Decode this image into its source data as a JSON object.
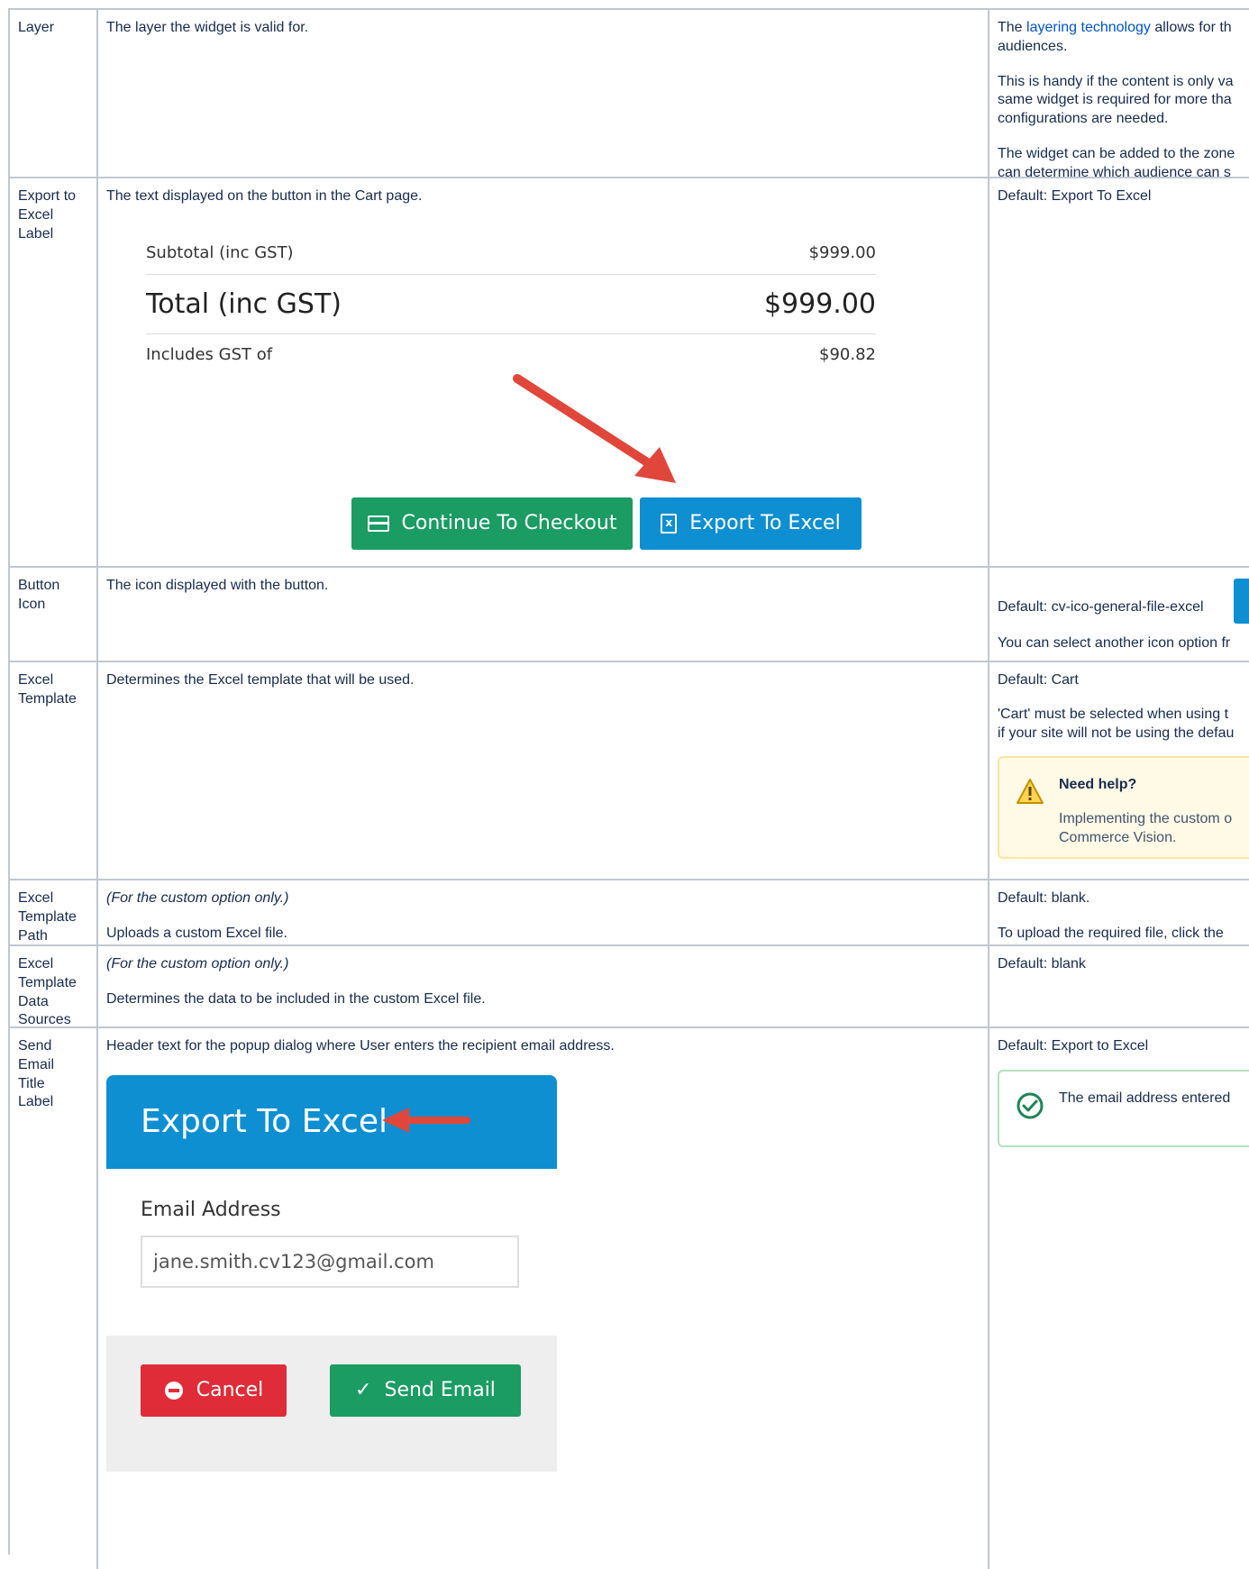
{
  "rows": [
    {
      "name": "Layer",
      "description": "The layer the widget is valid for.",
      "notes": {
        "p1_prefix": "The ",
        "p1_link": "layering technology",
        "p1_suffix": " allows for th",
        "p1_line2": "audiences.",
        "p2_line1": "This is handy if the content is only va",
        "p2_line2": "same widget is required for more tha",
        "p2_line3": "configurations are needed.",
        "p3_line1": "The widget can be added to the zone",
        "p3_line2": "can determine which audience can s"
      }
    },
    {
      "name": "Export to Excel Label",
      "description": "The text displayed on the button in the Cart page.",
      "notes": "Default: Export To Excel",
      "cart": {
        "subtotal_label": "Subtotal (inc GST)",
        "subtotal_value": "$999.00",
        "total_label": "Total (inc GST)",
        "total_value": "$999.00",
        "gst_label": "Includes GST of",
        "gst_value": "$90.82",
        "checkout_button": "Continue To Checkout",
        "export_button": "Export To Excel"
      }
    },
    {
      "name": "Button Icon",
      "description": "The icon displayed with the button.",
      "notes_default": "Default: cv-ico-general-file-excel",
      "notes_more": "You can select another icon option fr"
    },
    {
      "name": "Excel Template",
      "description": "Determines the Excel template that will be used.",
      "notes_default": "Default: Cart",
      "notes_line1": "'Cart' must be selected when using t",
      "notes_line2": "if your site will not be using the defau",
      "help_title": "Need help?",
      "help_line1": "Implementing the custom o",
      "help_line2": "Commerce Vision."
    },
    {
      "name": "Excel Template Path",
      "description_note": "(For the custom option only.)",
      "description": "Uploads a custom Excel file.",
      "notes_default": "Default: blank.",
      "notes_more": "To upload the required file, click the"
    },
    {
      "name": "Excel Template Data Sources",
      "description_note": "(For the custom option only.)",
      "description": "Determines the data to be included in the custom Excel file.",
      "notes_default": "Default: blank"
    },
    {
      "name": "Send Email Title Label",
      "description": "Header text for the popup dialog where User enters the recipient email address.",
      "notes_default": "Default: Export to Excel",
      "success_text": "The email address entered",
      "dialog": {
        "title": "Export To Excel",
        "email_label": "Email Address",
        "email_value": "jane.smith.cv123@gmail.com",
        "cancel_button": "Cancel",
        "send_button": "Send Email"
      }
    }
  ],
  "colors": {
    "border": "#c1c7d0",
    "link": "#0052cc",
    "green_button": "#1a9c63",
    "blue_button": "#0d8fd1",
    "red_button": "#df2c38",
    "arrow": "#e0463a",
    "warning_bg": "#fffae6",
    "warning_border": "#ffe49d",
    "success_border": "#b3dfc0"
  },
  "icons": [
    "card-icon",
    "excel-file-icon",
    "warning-icon",
    "check-circle-icon",
    "minus-circle-icon",
    "checkmark-icon",
    "arrow-annotation-icon"
  ]
}
